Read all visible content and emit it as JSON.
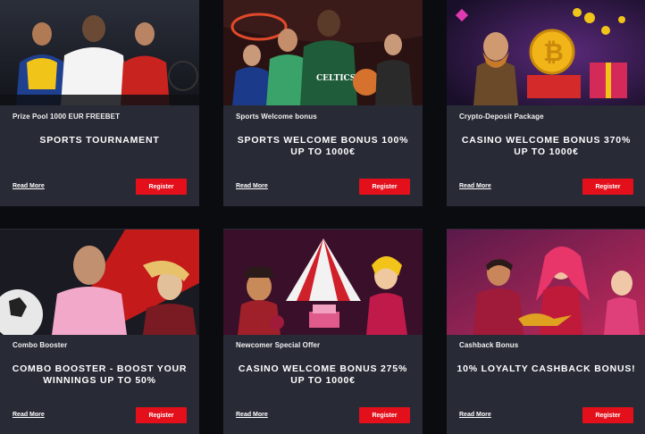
{
  "cards": [
    {
      "subtitle": "Prize Pool 1000 EUR FREEBET",
      "headline": "SPORTS TOURNAMENT",
      "read_more": "Read More",
      "register": "Register",
      "banner_icon": "athletes-image"
    },
    {
      "subtitle": "Sports Welcome bonus",
      "headline": "SPORTS WELCOME BONUS 100% UP TO 1000€",
      "read_more": "Read More",
      "register": "Register",
      "banner_icon": "basketball-players-image"
    },
    {
      "subtitle": "Crypto-Deposit Package",
      "headline": "CASINO WELCOME BONUS 370% UP TO 1000€",
      "read_more": "Read More",
      "register": "Register",
      "banner_icon": "bitcoin-treasure-image"
    },
    {
      "subtitle": "Combo Booster",
      "headline": "COMBO BOOSTER - BOOST YOUR WINNINGS UP TO 50%",
      "read_more": "Read More",
      "register": "Register",
      "banner_icon": "football-players-image"
    },
    {
      "subtitle": "Newcomer Special Offer",
      "headline": "CASINO WELCOME BONUS 275% UP TO 1000€",
      "read_more": "Read More",
      "register": "Register",
      "banner_icon": "circus-characters-image"
    },
    {
      "subtitle": "Cashback Bonus",
      "headline": "10% LOYALTY CASHBACK BONUS!",
      "read_more": "Read More",
      "register": "Register",
      "banner_icon": "genie-lamp-image"
    }
  ],
  "colors": {
    "page_bg": "#0b0c10",
    "card_bg": "#282b36",
    "register_button": "#e3101b"
  }
}
